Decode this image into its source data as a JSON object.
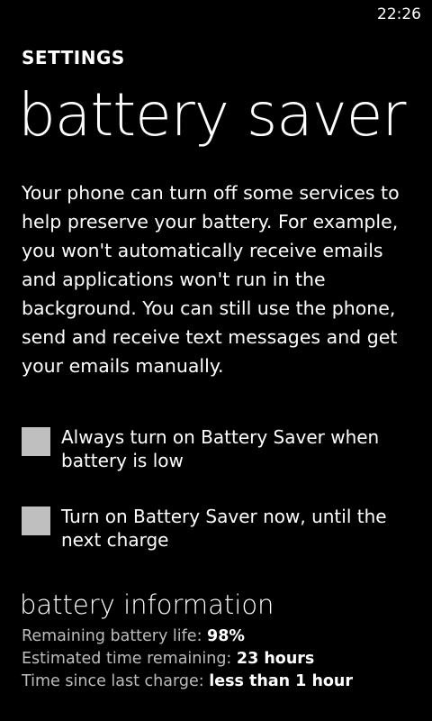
{
  "status_bar": {
    "time": "22:26"
  },
  "header": {
    "app_title": "SETTINGS",
    "page_title": "battery saver"
  },
  "description": "Your phone can turn off some services to help preserve your battery. For example, you won't automatically receive emails and applications won't run in the background. You can still use the phone, send and receive text messages and get your emails manually.",
  "options": [
    {
      "label": "Always turn on Battery Saver when battery is low",
      "checked": false
    },
    {
      "label": "Turn on Battery Saver now, until the next charge",
      "checked": false
    }
  ],
  "battery_info": {
    "heading": "battery information",
    "rows": [
      {
        "label": "Remaining battery life: ",
        "value": "98%"
      },
      {
        "label": "Estimated time remaining: ",
        "value": "23 hours"
      },
      {
        "label": "Time since last charge: ",
        "value": "less than 1 hour"
      }
    ]
  },
  "colors": {
    "background": "#000000",
    "text": "#ffffff",
    "secondary_text": "#bdbdbd",
    "checkbox_fill": "#bfbfbf"
  }
}
